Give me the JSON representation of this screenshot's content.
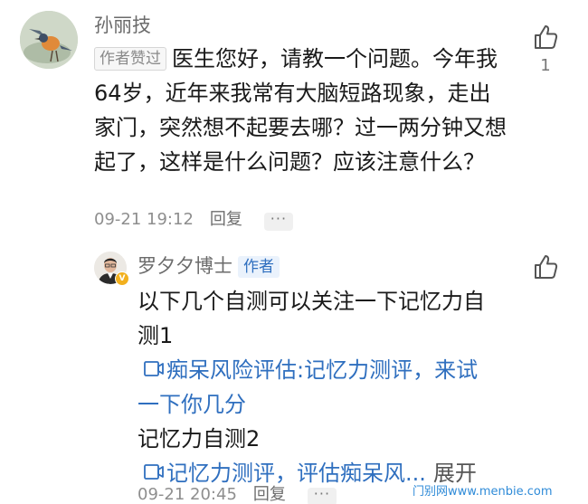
{
  "main_comment": {
    "username": "孙丽技",
    "badge": "作者赞过",
    "text": "医生您好，请教一个问题。今年我64岁，近年来我常有大脑短路现象，走出家门，突然想不起要去哪？过一两分钟又想起了，这样是什么问题？应该注意什么？",
    "timestamp": "09-21 19:12",
    "reply_label": "回复",
    "more_label": "···",
    "like_count": "1",
    "like_icon": "thumbs-up-icon"
  },
  "reply_comment": {
    "username": "罗夕夕博士",
    "badge": "作者",
    "line1": "以下几个自测可以关注一下记忆力自",
    "line2": "测1",
    "link1_line1": "痴呆风险评估:记忆力测评，来试",
    "link1_line2": "一下你几分",
    "line3": "记忆力自测2",
    "link2_text": "记忆力测评，评估痴呆风...",
    "expand_label": "展开",
    "timestamp": "09-21 20:45",
    "reply_label": "回复",
    "more_label": "···",
    "like_icon": "thumbs-up-icon",
    "link_icon": "video-link-icon",
    "verified_icon": "verified-v-icon",
    "verified_symbol": "V"
  },
  "watermark": "门别网www.menbie.com",
  "colors": {
    "link": "#2f6fbf",
    "badge_bg": "#eaf2fc",
    "meta": "#8e8e8e",
    "verified": "#f2b01e"
  }
}
